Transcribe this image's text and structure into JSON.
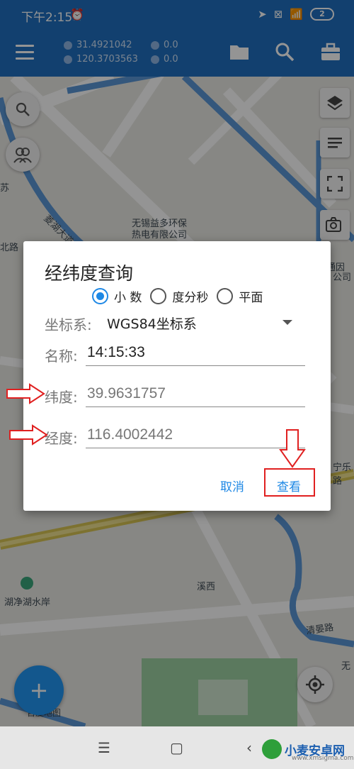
{
  "status_bar": {
    "time": "下午2:15",
    "battery": "2"
  },
  "app_bar": {
    "lat": "31.4921042",
    "lng": "120.3703563",
    "altitude": "0.0",
    "speed": "0.0"
  },
  "map": {
    "labels": {
      "poi_line1": "无锡益多环保",
      "poi_line2": "热电有限公司",
      "road_feihu": "菱湖大道",
      "xixi": "溪西",
      "qingyan_road": "清晏路",
      "jingshui": "湖净湖水岸",
      "right_mark1": "州通因",
      "right_mark2": "公司",
      "right_mark3": "无",
      "left_mark": "苏",
      "left_mark2": "北路",
      "lexi": "宁乐路",
      "attribution": "百度地图"
    }
  },
  "dialog": {
    "title": "经纬度查询",
    "options": [
      "小 数",
      "度分秒",
      "平面"
    ],
    "selected_option": "小 数",
    "coord_system_label": "坐标系:",
    "coord_system_value": "WGS84坐标系",
    "name_label": "名称:",
    "name_value": "14:15:33",
    "lat_label": "纬度:",
    "lat_value": "39.9631757",
    "lng_label": "经度:",
    "lng_value": "116.4002442",
    "cancel": "取消",
    "view": "查看"
  },
  "watermark": {
    "name": "小麦安卓网",
    "url": "www.xmsigma.com"
  },
  "colors": {
    "app_bar": "#1f6fc0",
    "accent": "#1e88e5",
    "annotation": "#e02020",
    "fab": "#2196f3"
  }
}
